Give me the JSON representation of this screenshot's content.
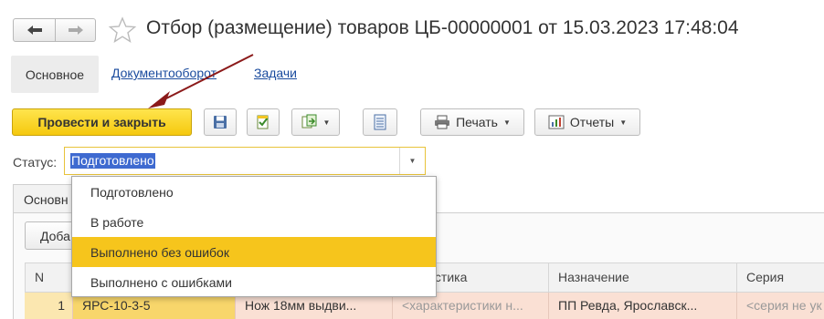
{
  "window": {
    "title": "Отбор (размещение) товаров ЦБ-00000001 от 15.03.2023 17:48:04"
  },
  "nav_tabs": {
    "main": "Основное",
    "docflow": "Документооборот",
    "tasks": "Задачи"
  },
  "toolbar": {
    "post_close_label": "Провести и закрыть",
    "print_label": "Печать",
    "reports_label": "Отчеты"
  },
  "status": {
    "label": "Статус:",
    "value": "Подготовлено",
    "options": [
      "Подготовлено",
      "В работе",
      "Выполнено без ошибок",
      "Выполнено с ошибками"
    ],
    "highlighted_option": "Выполнено без ошибок"
  },
  "inner_tab": "Основн",
  "add_button": "Доба",
  "table": {
    "headers": [
      "N",
      "",
      "",
      "ктеристика",
      "Назначение",
      "Серия"
    ],
    "row": [
      "1",
      "ЯРС-10-3-5",
      "Нож 18мм выдви...",
      "<характеристики н...",
      "ПП Ревда, Ярославск...",
      "<серия не ук"
    ]
  },
  "colors": {
    "accent_yellow": "#f5c90e",
    "highlight": "#f6c51c",
    "selection_blue": "#3e6ad0",
    "row_highlight": "#fae0d4",
    "arrow": "#8b1a1a"
  }
}
